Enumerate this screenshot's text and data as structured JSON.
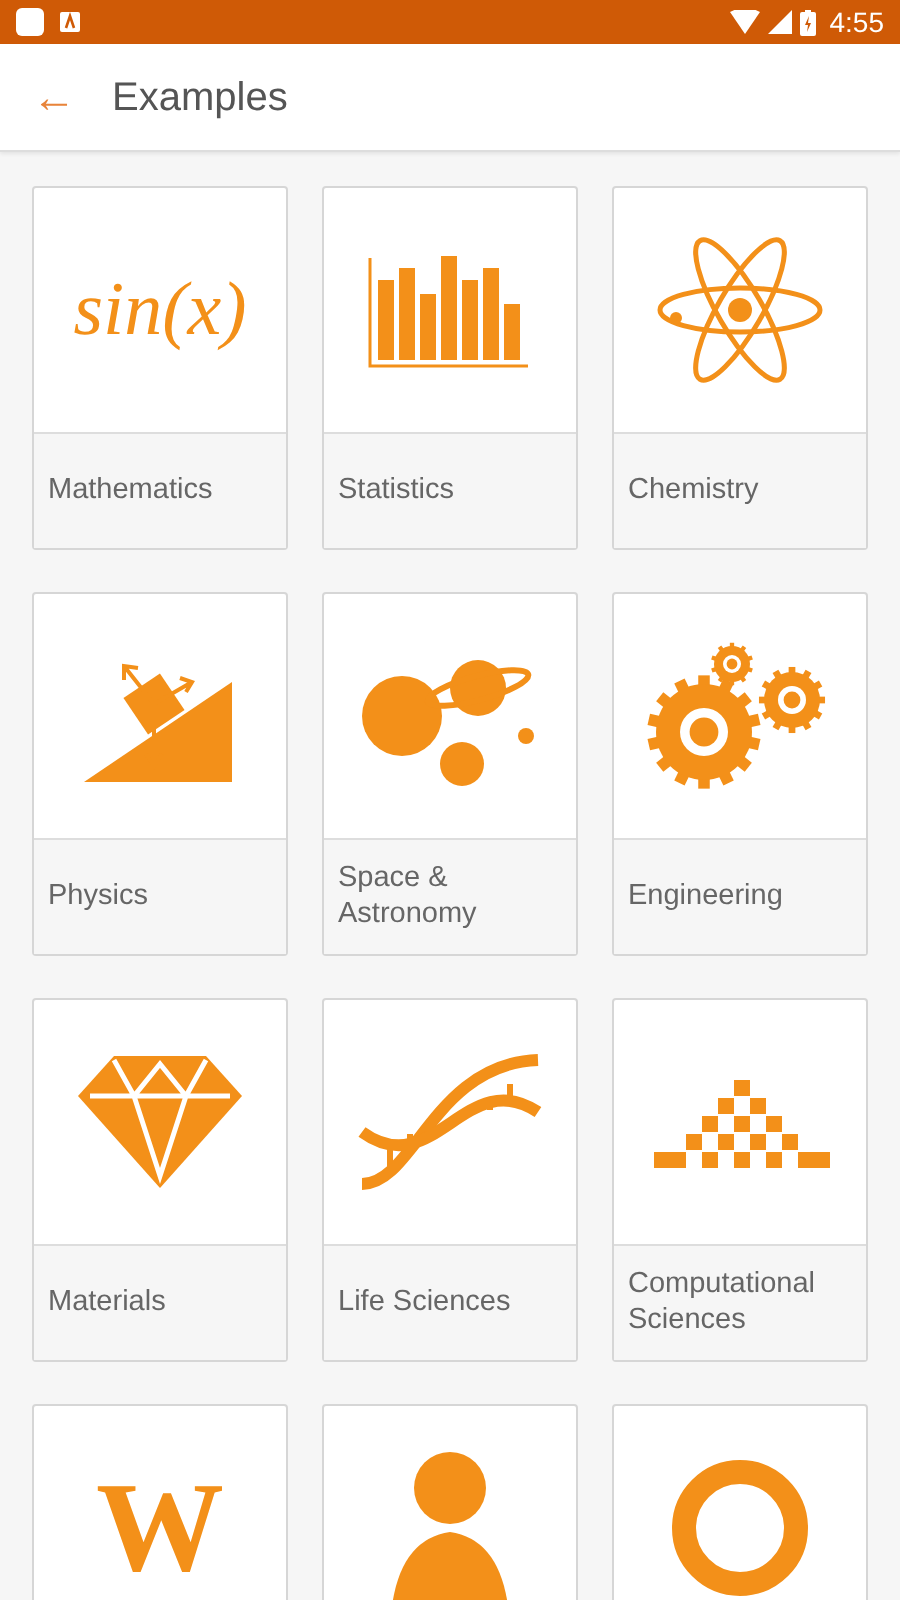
{
  "status_bar": {
    "time": "4:55"
  },
  "app_bar": {
    "back": "←",
    "title": "Examples"
  },
  "tiles": [
    {
      "kind": "formula",
      "icon_text": "sin(x)",
      "label": "Mathematics"
    },
    {
      "kind": "chart",
      "label": "Statistics"
    },
    {
      "kind": "atom",
      "label": "Chemistry"
    },
    {
      "kind": "incline",
      "label": "Physics"
    },
    {
      "kind": "planets",
      "label": "Space & Astronomy"
    },
    {
      "kind": "gears",
      "label": "Engineering"
    },
    {
      "kind": "diamond",
      "label": "Materials"
    },
    {
      "kind": "helix",
      "label": "Life Sciences"
    },
    {
      "kind": "pyramid",
      "label": "Computational Sciences"
    },
    {
      "kind": "letter",
      "icon_text": "W"
    },
    {
      "kind": "figure"
    },
    {
      "kind": "ring"
    }
  ]
}
